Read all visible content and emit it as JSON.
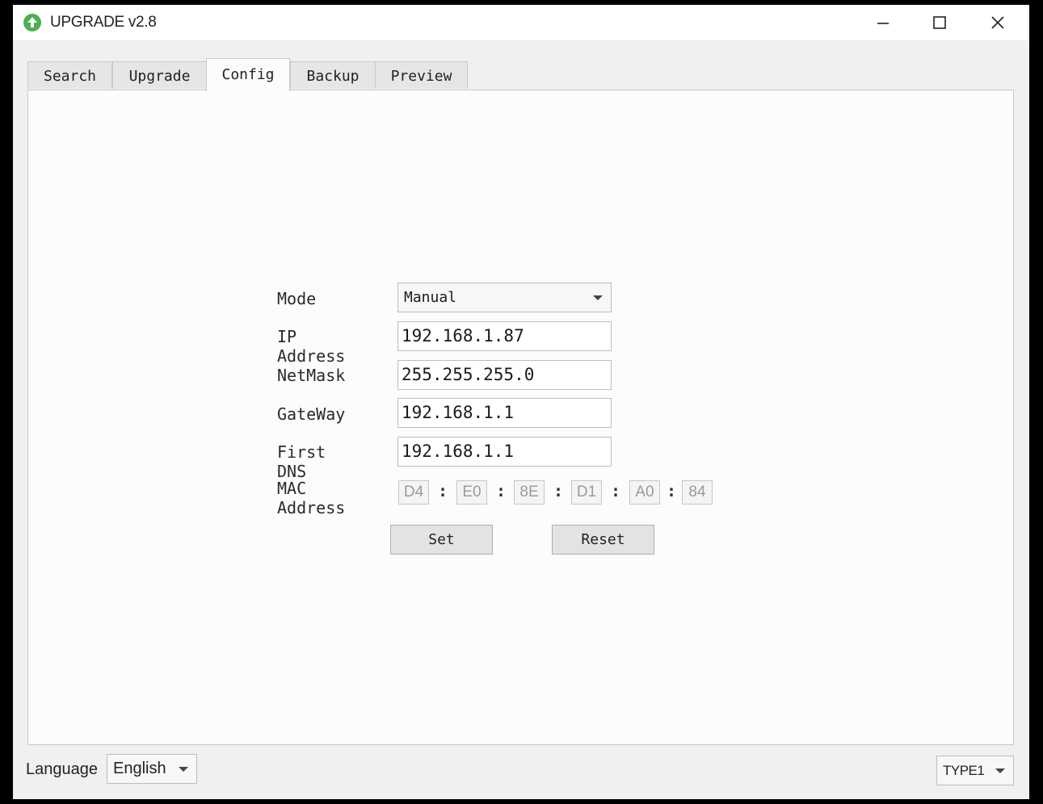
{
  "window": {
    "title": "UPGRADE v2.8",
    "accent_color": "#4caf50"
  },
  "tabs": [
    {
      "label": "Search",
      "active": false
    },
    {
      "label": "Upgrade",
      "active": false
    },
    {
      "label": "Config",
      "active": true
    },
    {
      "label": "Backup",
      "active": false
    },
    {
      "label": "Preview",
      "active": false
    }
  ],
  "config": {
    "mode": {
      "label": "Mode",
      "value": "Manual"
    },
    "ip_address": {
      "label": "IP Address",
      "value": "192.168.1.87"
    },
    "netmask": {
      "label": "NetMask",
      "value": "255.255.255.0"
    },
    "gateway": {
      "label": "GateWay",
      "value": "192.168.1.1"
    },
    "first_dns": {
      "label": "First DNS",
      "value": "192.168.1.1"
    },
    "mac_address": {
      "label": "MAC Address",
      "octets": [
        "D4",
        "E0",
        "8E",
        "D1",
        "A0",
        "84"
      ],
      "separator": ":"
    },
    "set_label": "Set",
    "reset_label": "Reset"
  },
  "footer": {
    "language_label": "Language",
    "language_value": "English",
    "type_value": "TYPE1"
  }
}
